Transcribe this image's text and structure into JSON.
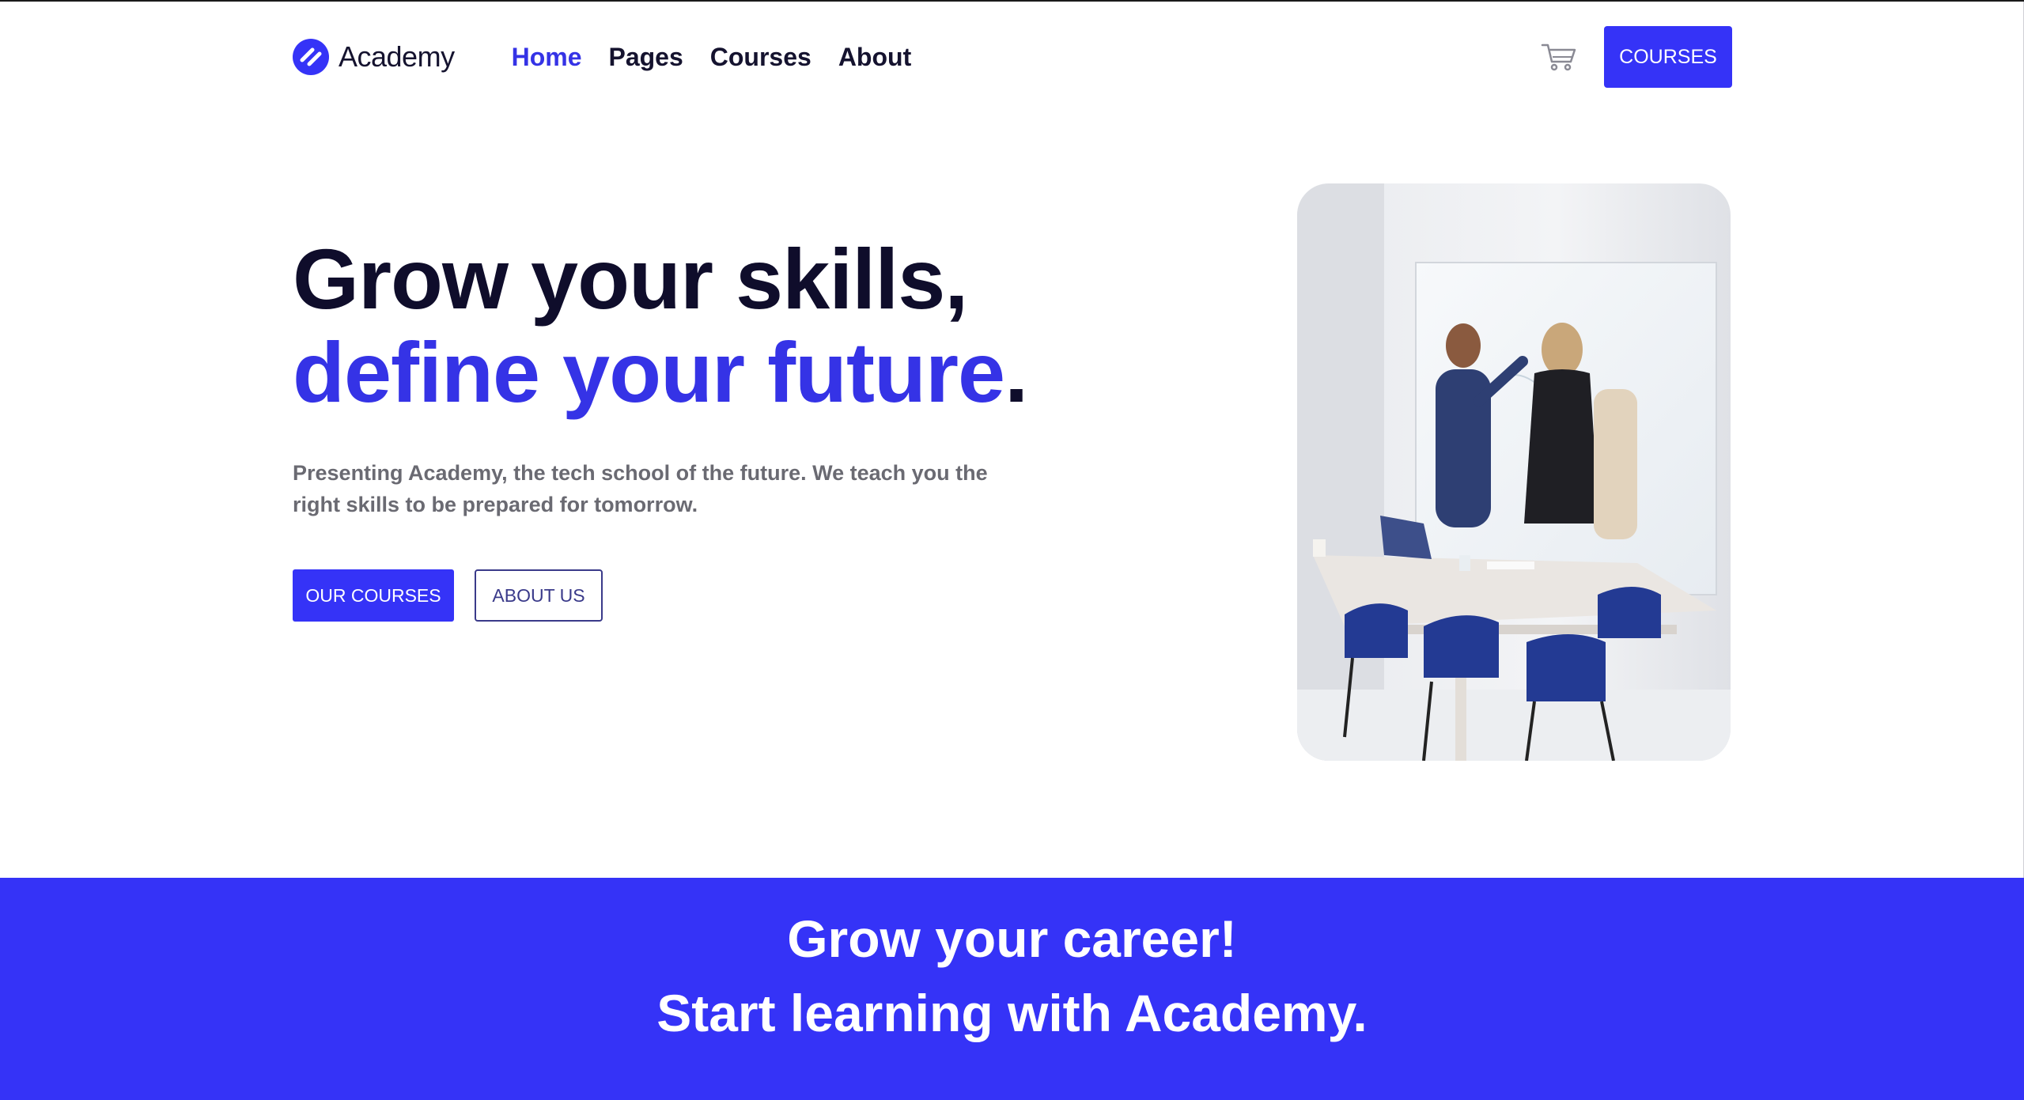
{
  "nav": {
    "brand": "Academy",
    "items": [
      {
        "label": "Home",
        "active": true
      },
      {
        "label": "Pages",
        "active": false
      },
      {
        "label": "Courses",
        "active": false
      },
      {
        "label": "About",
        "active": false
      }
    ],
    "cta": "COURSES"
  },
  "hero": {
    "title_line1": "Grow your skills,",
    "title_line2_accent": "define your future",
    "title_line2_end": ".",
    "subtitle_line1": "Presenting Academy, the tech school of the future. We teach you the",
    "subtitle_line2": "right skills to be prepared for tomorrow.",
    "primary_button": "OUR COURSES",
    "secondary_button": "ABOUT US"
  },
  "banner": {
    "line1": "Grow your career!",
    "line2": "Start learning with Academy."
  },
  "icons": {
    "brand": "academy-logo-icon",
    "cart": "cart-icon"
  },
  "colors": {
    "accent": "#3533e6",
    "button": "#3533f7",
    "banner": "#3533f7",
    "heading": "#0f0d2b",
    "subtitle": "#6a6a72"
  }
}
